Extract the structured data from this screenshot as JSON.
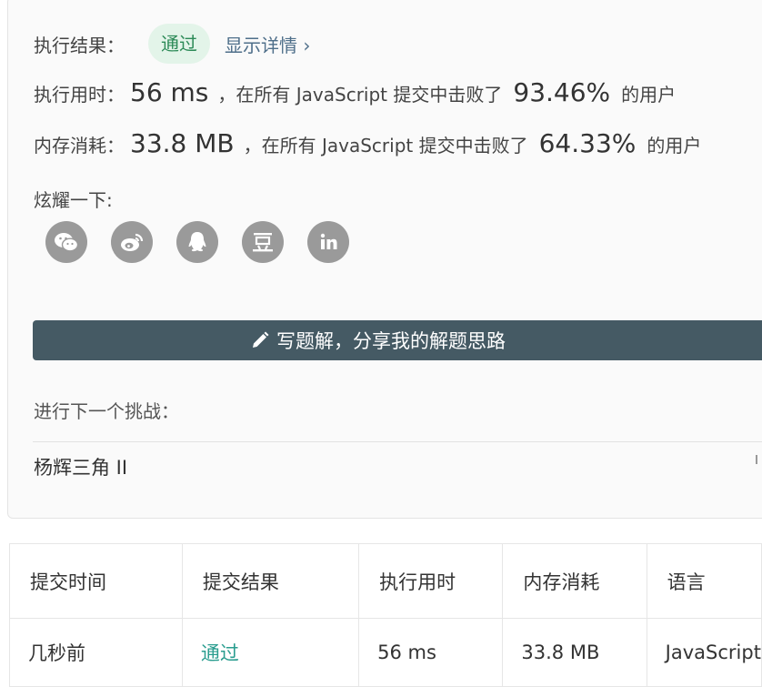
{
  "result": {
    "label": "执行结果：",
    "status": "通过",
    "details_link": "显示详情 ›"
  },
  "runtime": {
    "label": "执行用时：",
    "value": "56 ms",
    "middle": "，在所有 JavaScript 提交中击败了",
    "percent": "93.46%",
    "suffix": "的用户"
  },
  "memory": {
    "label": "内存消耗：",
    "value": "33.8 MB",
    "middle": "，在所有 JavaScript 提交中击败了",
    "percent": "64.33%",
    "suffix": "的用户"
  },
  "share": {
    "label": "炫耀一下:",
    "icons": [
      "wechat-icon",
      "weibo-icon",
      "qq-icon",
      "douban-icon",
      "linkedin-icon"
    ]
  },
  "write_solution_button": "写题解，分享我的解题思路",
  "next_challenge": {
    "label": "进行下一个挑战：",
    "item": "杨辉三角 II"
  },
  "submissions": {
    "headers": [
      "提交时间",
      "提交结果",
      "执行用时",
      "内存消耗",
      "语言"
    ],
    "rows": [
      {
        "time": "几秒前",
        "result": "通过",
        "runtime": "56 ms",
        "memory": "33.8 MB",
        "language": "JavaScript"
      }
    ]
  },
  "colors": {
    "pass_badge_bg": "#e3f4e9",
    "pass_text": "#2c8a57",
    "button_bg": "#455a64",
    "icon_bg": "#9a9a9a"
  }
}
